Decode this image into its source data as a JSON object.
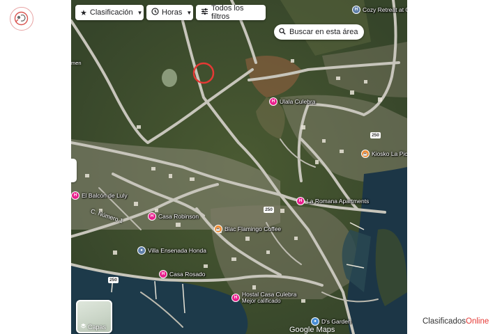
{
  "filters": {
    "rating": {
      "label": "Clasificación",
      "icon": "star-icon"
    },
    "hours": {
      "label": "Horas",
      "icon": "clock-icon"
    },
    "all": {
      "label": "Todos los filtros",
      "icon": "filter-sliders-icon"
    }
  },
  "search_area": {
    "label": "Buscar en esta área",
    "icon": "search-icon"
  },
  "map": {
    "places": [
      {
        "name": "Cozy Retreat at Culebra",
        "kind": "lodging",
        "color": "#5f7fa8"
      },
      {
        "name": "Ulala Culebra",
        "kind": "lodging",
        "color": "#e91e8c"
      },
      {
        "name": "Kiosko La Pic",
        "kind": "food",
        "color": "#f28b30"
      },
      {
        "name": "El Balcón de Luly",
        "kind": "lodging",
        "color": "#e91e8c"
      },
      {
        "name": "La Romana Apartments",
        "kind": "lodging",
        "color": "#e91e8c"
      },
      {
        "name": "Casa Robinson",
        "kind": "lodging",
        "color": "#e91e8c"
      },
      {
        "name": "Blac Flamingo Coffee",
        "kind": "food",
        "color": "#f28b30"
      },
      {
        "name": "Villa Ensenada Honda",
        "kind": "place",
        "color": "#5f7fa8"
      },
      {
        "name": "Casa Rosado",
        "kind": "lodging",
        "color": "#e91e8c"
      },
      {
        "name": "Hostal Casa Culebra",
        "subtitle": "Mejor calificado",
        "kind": "lodging",
        "color": "#e91e8c"
      },
      {
        "name": "D's Garden",
        "kind": "place",
        "color": "#4a8fd6"
      }
    ],
    "road_labels": [
      "men",
      "C. Número 1"
    ],
    "route_shields": [
      "250",
      "250",
      "250"
    ],
    "marker_color": "#e53935"
  },
  "layers": {
    "label": "Capas",
    "icon": "layers-icon"
  },
  "attribution": "Google Maps",
  "brand": {
    "text_main": "Clasificados",
    "text_accent": "Online"
  }
}
